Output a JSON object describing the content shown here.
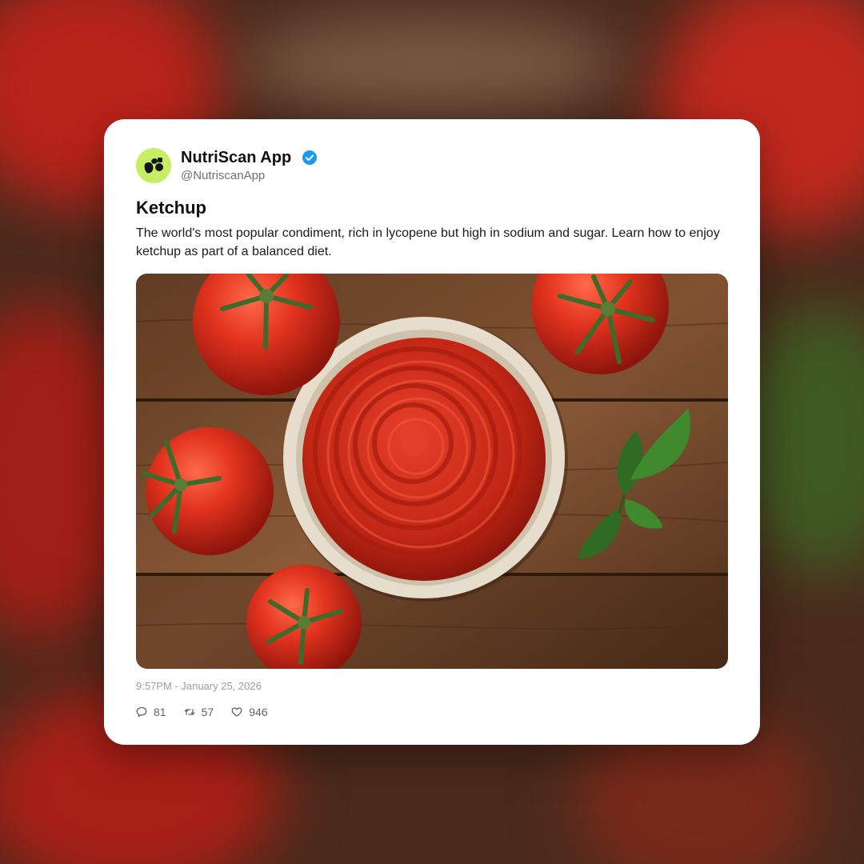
{
  "post": {
    "author_name": "NutriScan App",
    "handle": "@NutriscanApp",
    "verified": true,
    "title": "Ketchup",
    "body": "The world's most popular condiment, rich in lycopene but high in sodium and sugar. Learn how to enjoy ketchup as part of a balanced diet.",
    "timestamp": "9:57PM - January 25, 2026",
    "image_subject": "bowl of ketchup surrounded by tomatoes and basil on wooden table"
  },
  "stats": {
    "replies": "81",
    "retweets": "57",
    "likes": "946"
  },
  "icons": {
    "avatar": "nutriscan-logo-icon",
    "verified": "verified-badge-icon",
    "reply": "reply-icon",
    "retweet": "retweet-icon",
    "like": "heart-icon"
  },
  "colors": {
    "avatar_bg": "#c6ee63",
    "verified_blue": "#1d9bf0",
    "ketchup_red": "#c8281a",
    "wood_brown": "#6e4428"
  }
}
